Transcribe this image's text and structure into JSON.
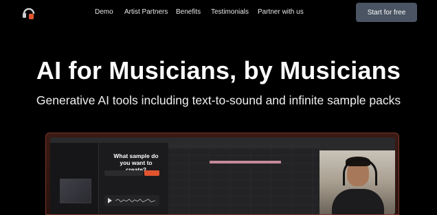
{
  "nav": {
    "links": [
      "Demo",
      "Artist Partners",
      "Benefits",
      "Testimonials",
      "Partner with us"
    ],
    "cta_label": "Start for free"
  },
  "hero": {
    "title": "AI for Musicians, by Musicians",
    "subtitle": "Generative AI tools including text-to-sound and infinite sample packs"
  },
  "app_preview": {
    "prompt_heading": "What sample do you want to create?"
  },
  "colors": {
    "background": "#000000",
    "cta": "#4a5462",
    "accent": "#e0552f"
  },
  "icons": {
    "logo": "headphones-logo-icon",
    "play": "play-icon"
  }
}
